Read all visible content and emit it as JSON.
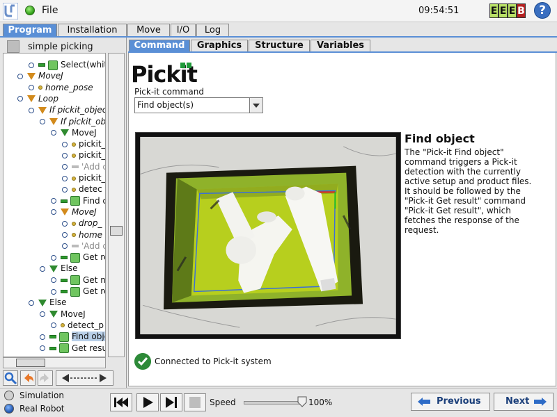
{
  "topbar": {
    "file_menu": "File",
    "clock": "09:54:51",
    "eeeb": [
      "E",
      "E",
      "E",
      "B"
    ]
  },
  "main_tabs": [
    "Program",
    "Installation",
    "Move",
    "I/O",
    "Log"
  ],
  "program_name": "simple picking",
  "tree": [
    {
      "label": "Select(white_bo",
      "indent": 2,
      "icon": "pickit",
      "dash": true
    },
    {
      "label": "MoveJ",
      "indent": 1,
      "icon": "tri-orange",
      "italic": true
    },
    {
      "label": "home_pose",
      "indent": 2,
      "icon": "dot",
      "italic": true
    },
    {
      "label": "Loop",
      "indent": 1,
      "icon": "tri-orange",
      "italic": true
    },
    {
      "label": "If pickit_object",
      "indent": 2,
      "icon": "tri-orange",
      "italic": true
    },
    {
      "label": "If pickit_obj",
      "indent": 3,
      "icon": "tri-orange",
      "italic": true
    },
    {
      "label": "MoveJ",
      "indent": 4,
      "icon": "tri-green"
    },
    {
      "label": "pickit_",
      "indent": 5,
      "icon": "dot"
    },
    {
      "label": "pickit_",
      "indent": 5,
      "icon": "dot"
    },
    {
      "label": "'Add c",
      "indent": 5,
      "icon": "dash-gray",
      "gray": true
    },
    {
      "label": "pickit_",
      "indent": 5,
      "icon": "dot"
    },
    {
      "label": "detec",
      "indent": 5,
      "icon": "dot"
    },
    {
      "label": "Find c",
      "indent": 4,
      "icon": "pickit",
      "dash": true
    },
    {
      "label": "MoveJ",
      "indent": 4,
      "icon": "tri-orange",
      "italic": true
    },
    {
      "label": "drop_",
      "indent": 5,
      "icon": "dot",
      "italic": true
    },
    {
      "label": "home",
      "indent": 5,
      "icon": "dot",
      "italic": true
    },
    {
      "label": "'Add c",
      "indent": 5,
      "icon": "dash-gray",
      "gray": true
    },
    {
      "label": "Get re",
      "indent": 4,
      "icon": "pickit",
      "dash": true
    },
    {
      "label": "Else",
      "indent": 3,
      "icon": "tri-green"
    },
    {
      "label": "Get n",
      "indent": 4,
      "icon": "pickit",
      "dash": true
    },
    {
      "label": "Get re",
      "indent": 4,
      "icon": "pickit",
      "dash": true
    },
    {
      "label": "Else",
      "indent": 2,
      "icon": "tri-green"
    },
    {
      "label": "MoveJ",
      "indent": 3,
      "icon": "tri-green"
    },
    {
      "label": "detect_p",
      "indent": 4,
      "icon": "dot"
    },
    {
      "label": "Find obje",
      "indent": 3,
      "icon": "pickit",
      "dash": true,
      "selected": true
    },
    {
      "label": "Get resu",
      "indent": 3,
      "icon": "pickit",
      "dash": true
    }
  ],
  "content_tabs": [
    "Command",
    "Graphics",
    "Structure",
    "Variables"
  ],
  "logo": {
    "pick": "Pick",
    "it": "it"
  },
  "command": {
    "label": "Pick-it command",
    "selected": "Find object(s)"
  },
  "description": {
    "title": "Find object",
    "lines": [
      "The \"Pick-it Find object\"",
      "command triggers a Pick-it",
      "detection with the currently",
      "active setup and product files.",
      "It should be followed by the",
      "\"Pick-it Get result\" command",
      "\"Pick-it Get result\", which",
      "fetches the response of the",
      "request."
    ]
  },
  "connection": "Connected to Pick-it system",
  "bottom": {
    "simulation": "Simulation",
    "real_robot": "Real Robot",
    "speed_label": "Speed",
    "speed_value": "100%",
    "speed_fraction": 1.0,
    "previous": "Previous",
    "next": "Next"
  },
  "colors": {
    "accent": "#5a8fd6",
    "ok_green": "#2d8a38",
    "bin_green": "#b7cf1e"
  }
}
